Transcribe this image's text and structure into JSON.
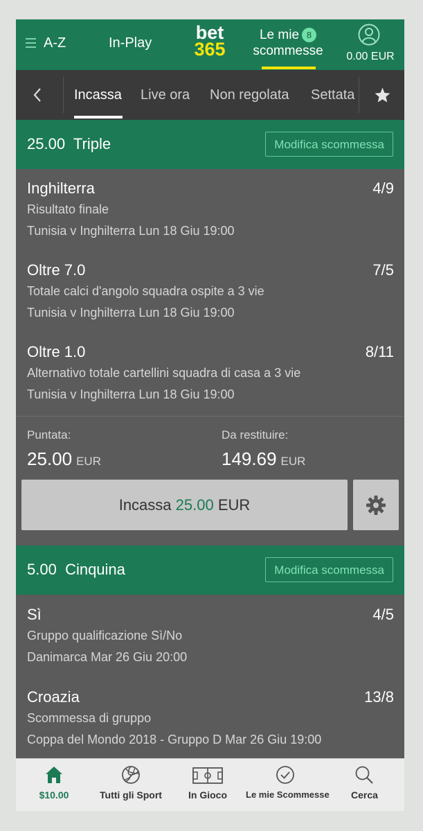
{
  "header": {
    "az_label": "A-Z",
    "inplay_label": "In-Play",
    "logo_top": "bet",
    "logo_bottom": "365",
    "mybets_line1": "Le mie",
    "mybets_line2": "scommesse",
    "mybets_count": "8",
    "balance": "0.00 EUR"
  },
  "tabs": [
    "Incassa",
    "Live ora",
    "Non regolata",
    "Settata"
  ],
  "bet1": {
    "stake": "25.00",
    "type": "Triple",
    "edit_label": "Modifica scommessa",
    "selections": [
      {
        "name": "Inghilterra",
        "odds": "4/9",
        "market": "Risultato finale",
        "event": "Tunisia v Inghilterra Lun 18 Giu 19:00"
      },
      {
        "name": "Oltre 7.0",
        "odds": "7/5",
        "market": "Totale calci d'angolo squadra ospite a 3 vie",
        "event": "Tunisia v Inghilterra Lun 18 Giu 19:00"
      },
      {
        "name": "Oltre 1.0",
        "odds": "8/11",
        "market": "Alternativo totale cartellini squadra di casa a 3 vie",
        "event": "Tunisia v Inghilterra Lun 18 Giu 19:00"
      }
    ],
    "stake_label": "Puntata:",
    "stake_value": "25.00",
    "stake_currency": "EUR",
    "return_label": "Da restituire:",
    "return_value": "149.69",
    "return_currency": "EUR",
    "cashout_prefix": "Incassa",
    "cashout_amount": "25.00",
    "cashout_currency": "EUR"
  },
  "bet2": {
    "stake": "5.00",
    "type": "Cinquina",
    "edit_label": "Modifica scommessa",
    "selections": [
      {
        "name": "Sì",
        "odds": "4/5",
        "market": "Gruppo qualificazione Sì/No",
        "event": "Danimarca Mar 26 Giu 20:00"
      },
      {
        "name": "Croazia",
        "odds": "13/8",
        "market": "Scommessa di gruppo",
        "event": "Coppa del Mondo 2018 - Gruppo D Mar 26 Giu 19:00"
      }
    ]
  },
  "bottom_nav": [
    {
      "label": "$10.00",
      "icon": "home-icon"
    },
    {
      "label": "Tutti gli Sport",
      "icon": "volleyball-icon"
    },
    {
      "label": "In Gioco",
      "icon": "pitch-icon"
    },
    {
      "label": "Le mie Scommesse",
      "icon": "check-circle-icon"
    },
    {
      "label": "Cerca",
      "icon": "search-icon"
    }
  ],
  "colors": {
    "brand_green": "#1c7a55",
    "accent_yellow": "#f5e50a",
    "panel_grey": "#5b5b5b"
  }
}
